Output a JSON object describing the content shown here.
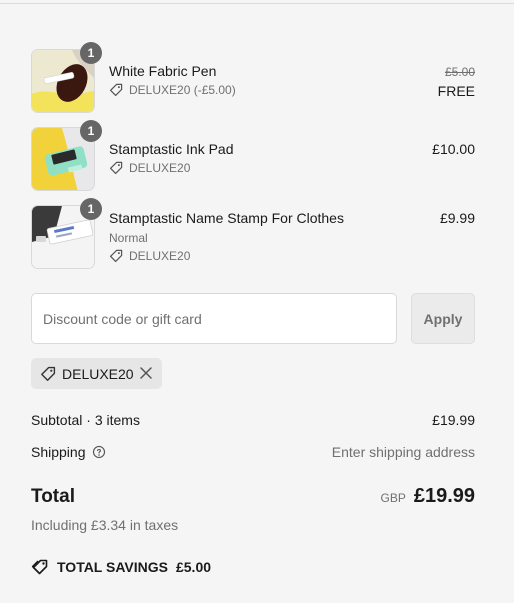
{
  "cart": {
    "items": [
      {
        "name": "White Fabric Pen",
        "quantity": "1",
        "variant": "",
        "discount": "DELUXE20 (-£5.00)",
        "original_price": "£5.00",
        "price": "FREE",
        "image": "white-fabric-pen-photo"
      },
      {
        "name": "Stamptastic Ink Pad",
        "quantity": "1",
        "variant": "",
        "discount": "DELUXE20",
        "original_price": "",
        "price": "£10.00",
        "image": "ink-pad-photo"
      },
      {
        "name": "Stamptastic Name Stamp For Clothes",
        "quantity": "1",
        "variant": "Normal",
        "discount": "DELUXE20",
        "original_price": "",
        "price": "£9.99",
        "image": "name-stamp-photo"
      }
    ]
  },
  "discount_form": {
    "placeholder": "Discount code or gift card",
    "value": "",
    "apply_label": "Apply"
  },
  "applied_code": {
    "code": "DELUXE20"
  },
  "summary": {
    "subtotal_label": "Subtotal · 3 items",
    "subtotal_value": "£19.99",
    "shipping_label": "Shipping",
    "shipping_value": "Enter shipping address",
    "total_label": "Total",
    "currency": "GBP",
    "total_value": "£19.99",
    "taxes_note": "Including £3.34 in taxes",
    "savings_label": "TOTAL SAVINGS",
    "savings_value": "£5.00"
  },
  "colors": {
    "background": "#f5f5f5",
    "text": "#1a1a1a",
    "muted": "#707070",
    "badge": "#666666"
  }
}
